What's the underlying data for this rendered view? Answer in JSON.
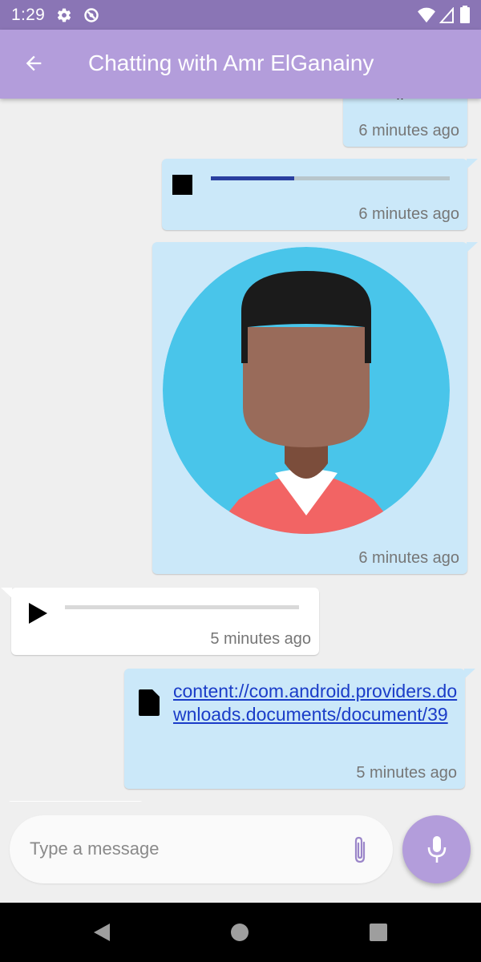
{
  "status_bar": {
    "time": "1:29",
    "icons": [
      "gear-icon",
      "sync-icon",
      "wifi-icon",
      "signal-icon",
      "battery-icon"
    ]
  },
  "app_bar": {
    "title": "Chatting with Amr ElGanainy",
    "back_icon": "arrow-back-icon",
    "color": "#b39ddb"
  },
  "messages": [
    {
      "kind": "text",
      "direction": "outgoing",
      "text": "..",
      "time": "6 minutes ago"
    },
    {
      "kind": "audio",
      "direction": "outgoing",
      "state": "playing",
      "progress": 0.35,
      "time": "6 minutes ago"
    },
    {
      "kind": "image",
      "direction": "outgoing",
      "image": "person-avatar",
      "time": "6 minutes ago"
    },
    {
      "kind": "audio",
      "direction": "incoming",
      "state": "paused",
      "progress": 0,
      "time": "5 minutes ago"
    },
    {
      "kind": "file",
      "direction": "outgoing",
      "link": "content://com.android.providers.downloads.documents/document/39",
      "time": "5 minutes ago"
    }
  ],
  "composer": {
    "placeholder": "Type a message",
    "value": "",
    "attach_icon": "paperclip-icon",
    "mic_icon": "mic-icon"
  },
  "colors": {
    "outgoing_bubble": "#cbe8f9",
    "incoming_bubble": "#ffffff",
    "accent": "#b39ddb",
    "status_bar": "#8a75b5",
    "link": "#1a3cc8"
  }
}
